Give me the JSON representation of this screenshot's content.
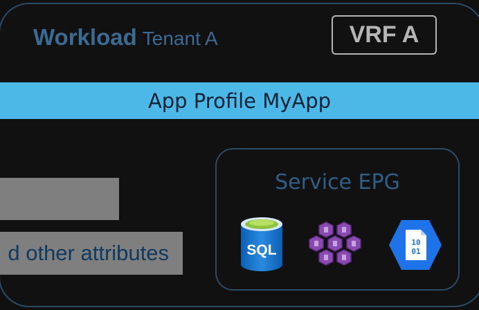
{
  "tenant": {
    "title_bold": "Workload",
    "title_name": "Tenant A",
    "vrf_label": "VRF A"
  },
  "app_profile": {
    "label": "App Profile MyApp"
  },
  "left_boxes": [
    {
      "label": ""
    },
    {
      "label": "d other attributes"
    }
  ],
  "service_epg": {
    "label": "Service EPG",
    "icons": [
      {
        "name": "sql-database-icon",
        "text": "SQL",
        "color": "#1e7fd1"
      },
      {
        "name": "kubernetes-cluster-icon",
        "color": "#8a4bb0"
      },
      {
        "name": "binary-storage-icon",
        "text": "10 01",
        "color": "#1f73e8"
      }
    ]
  },
  "colors": {
    "background": "#101010",
    "border": "#2b4c66",
    "app_profile_bar": "#4cb8e8",
    "grey_box": "#7f7f7f",
    "title_text": "#3b6a92"
  }
}
